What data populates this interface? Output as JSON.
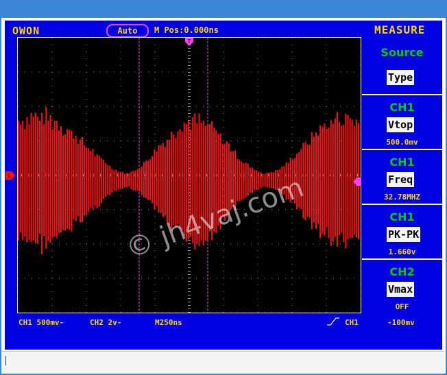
{
  "window": {
    "title": ""
  },
  "header": {
    "brand": "OWON",
    "trigger_mode": "Auto",
    "m_pos_label": "M Pos:0.000ns",
    "menu_title": "MEASURE"
  },
  "menu": {
    "items": [
      {
        "label": "Source",
        "value": "Type",
        "reading": ""
      },
      {
        "label": "CH1",
        "value": "Vtop",
        "reading": "500.0mv"
      },
      {
        "label": "CH1",
        "value": "Freq",
        "reading": "32.78MHZ"
      },
      {
        "label": "CH1",
        "value": "PK-PK",
        "reading": "1.660v"
      },
      {
        "label": "CH2",
        "value": "Vmax",
        "reading": "OFF"
      }
    ]
  },
  "status": {
    "ch1_scale": "CH1  500mv-",
    "ch2_scale": "CH2  2v-",
    "timebase": "M250ns",
    "trigger_source": "CH1",
    "trigger_level": "-100mv"
  },
  "watermark": "© jh4vaj.com",
  "colors": {
    "frame": "#0000e0",
    "trace": "#ff1010",
    "text": "#ffd800",
    "menu_label": "#00d000",
    "marker": "#ff40ff"
  },
  "chart_data": {
    "type": "line",
    "description_kind": "oscilloscope waveform",
    "series": [
      {
        "name": "CH1",
        "frequency": "32.78MHZ",
        "peak_to_peak": "1.660v",
        "vtop": "500.0mv"
      }
    ],
    "envelope_relative": [
      0.95,
      0.98,
      1.0,
      0.9,
      0.72,
      0.52,
      0.32,
      0.14,
      0.06,
      0.18,
      0.42,
      0.68,
      0.9,
      0.97,
      0.86,
      0.62,
      0.36,
      0.16,
      0.06,
      0.12,
      0.32,
      0.56,
      0.8,
      0.95,
      0.98,
      0.88
    ]
  }
}
